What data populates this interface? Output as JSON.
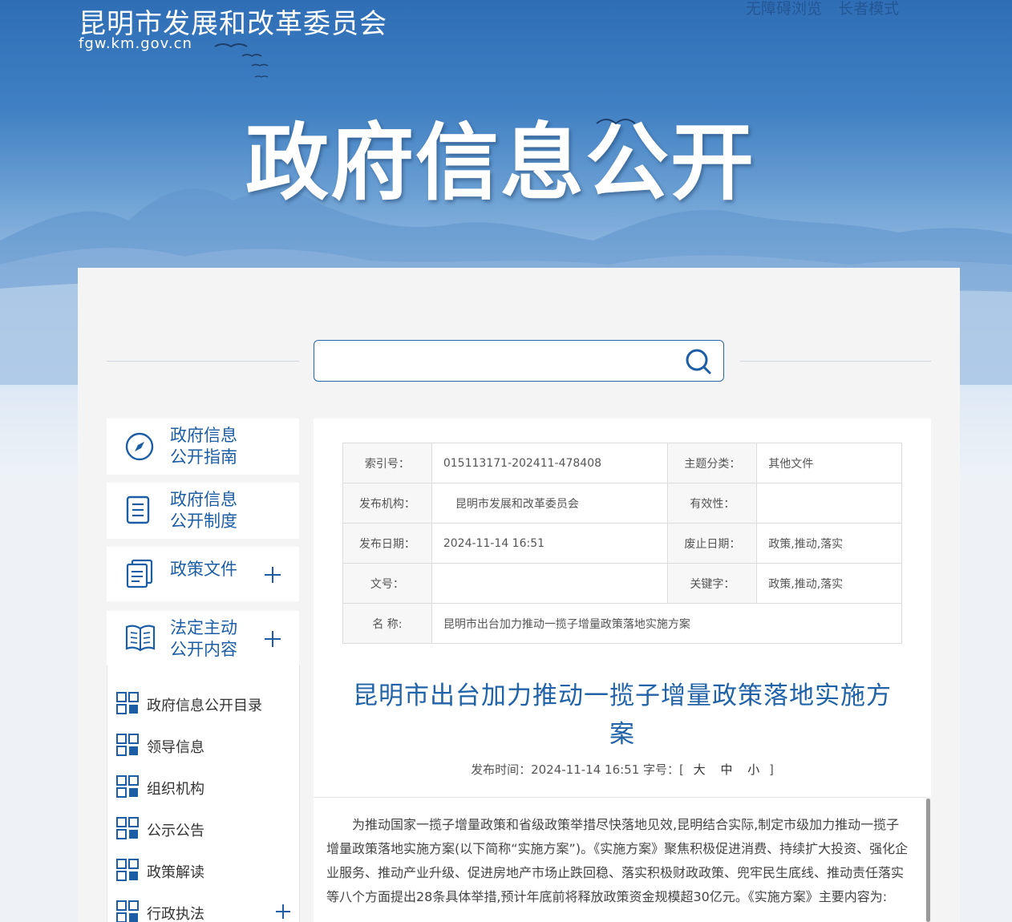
{
  "header": {
    "site_name": "昆明市发展和改革委员会",
    "site_domain": "fgw.km.gov.cn",
    "accessibility_link": "无障碍浏览",
    "elder_mode_link": "长者模式",
    "hero_title": "政府信息公开"
  },
  "search": {
    "placeholder": ""
  },
  "sidebar": {
    "cards": [
      {
        "line1": "政府信息",
        "line2": "公开指南",
        "icon": "compass-icon"
      },
      {
        "line1": "政府信息",
        "line2": "公开制度",
        "icon": "document-list-icon"
      },
      {
        "line1": "政策文件",
        "line2": "",
        "icon": "documents-icon",
        "expandable": true
      },
      {
        "line1": "法定主动",
        "line2": "公开内容",
        "icon": "open-book-icon",
        "expandable": true
      }
    ],
    "submenu": [
      {
        "label": "政府信息公开目录"
      },
      {
        "label": "领导信息"
      },
      {
        "label": "组织机构"
      },
      {
        "label": "公示公告"
      },
      {
        "label": "政策解读"
      },
      {
        "label": "行政执法",
        "expandable": true
      }
    ]
  },
  "meta": {
    "index_label": "索引号：",
    "index_value": "015113171-202411-478408",
    "topic_label": "主题分类：",
    "topic_value": "其他文件",
    "publisher_label": "发布机构：",
    "publisher_value": "昆明市发展和改革委员会",
    "validity_label": "有效性：",
    "validity_value": "",
    "date_label": "发布日期：",
    "date_value": "2024-11-14 16:51",
    "expire_label": "废止日期：",
    "expire_value": "政策,推动,落实",
    "docno_label": "文号：",
    "docno_value": "",
    "keywords_label": "关键字：",
    "keywords_value": "政策,推动,落实",
    "name_label": "名 称:",
    "name_value": "昆明市出台加力推动一揽子增量政策落地实施方案"
  },
  "article": {
    "title": "昆明市出台加力推动一揽子增量政策落地实施方案",
    "pub_prefix": "发布时间：2024-11-14 16:51 字号：[",
    "size_large": "大",
    "size_medium": "中",
    "size_small": "小",
    "pub_suffix": "]",
    "body": "为推动国家一揽子增量政策和省级政策举措尽快落地见效,昆明结合实际,制定市级加力推动一揽子增量政策落地实施方案(以下简称“实施方案”)。《实施方案》聚焦积极促进消费、持续扩大投资、强化企业服务、推动产业升级、促进房地产市场止跌回稳、落实积极财政政策、兜牢民生底线、推动责任落实等八个方面提出28条具体举措,预计年底前将释放政策资金规模超30亿元。《实施方案》主要内容为:"
  },
  "colors": {
    "brand_blue": "#1c5ea6",
    "title_blue": "#2163a8"
  }
}
